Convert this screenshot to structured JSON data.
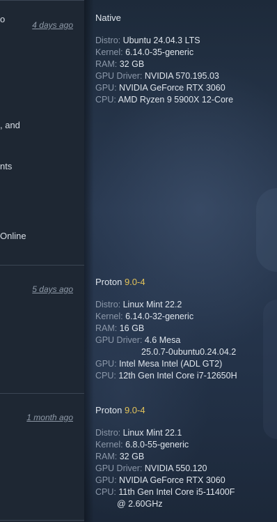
{
  "left": {
    "fragments": [
      "o",
      ", and",
      "nts",
      "Online"
    ],
    "dates": [
      "4 days ago",
      "5 days ago",
      "1 month ago"
    ]
  },
  "reports": [
    {
      "head": "Native",
      "version": "",
      "specs": {
        "distro_label": "Distro:",
        "distro": "Ubuntu 24.04.3 LTS",
        "kernel_label": "Kernel:",
        "kernel": "6.14.0-35-generic",
        "ram_label": "RAM:",
        "ram": "32 GB",
        "gpu_driver_label": "GPU Driver:",
        "gpu_driver": "NVIDIA 570.195.03",
        "gpu_label": "GPU:",
        "gpu": "NVIDIA GeForce RTX 3060",
        "cpu_label": "CPU:",
        "cpu": "AMD Ryzen 9 5900X 12-Core"
      }
    },
    {
      "head": "Proton",
      "version": "9.0-4",
      "specs": {
        "distro_label": "Distro:",
        "distro": "Linux Mint 22.2",
        "kernel_label": "Kernel:",
        "kernel": "6.14.0-32-generic",
        "ram_label": "RAM:",
        "ram": "16 GB",
        "gpu_driver_label": "GPU Driver:",
        "gpu_driver": "4.6 Mesa",
        "gpu_driver_cont": "25.0.7-0ubuntu0.24.04.2",
        "gpu_label": "GPU:",
        "gpu": "Intel Mesa Intel (ADL GT2)",
        "cpu_label": "CPU:",
        "cpu": "12th Gen Intel Core i7-12650H"
      }
    },
    {
      "head": "Proton",
      "version": "9.0-4",
      "specs": {
        "distro_label": "Distro:",
        "distro": "Linux Mint 22.1",
        "kernel_label": "Kernel:",
        "kernel": "6.8.0-55-generic",
        "ram_label": "RAM:",
        "ram": "32 GB",
        "gpu_driver_label": "GPU Driver:",
        "gpu_driver": "NVIDIA 550.120",
        "gpu_label": "GPU:",
        "gpu": "NVIDIA GeForce RTX 3060",
        "cpu_label": "CPU:",
        "cpu": "11th Gen Intel Core i5-11400F",
        "cpu_cont": "@ 2.60GHz"
      }
    }
  ]
}
